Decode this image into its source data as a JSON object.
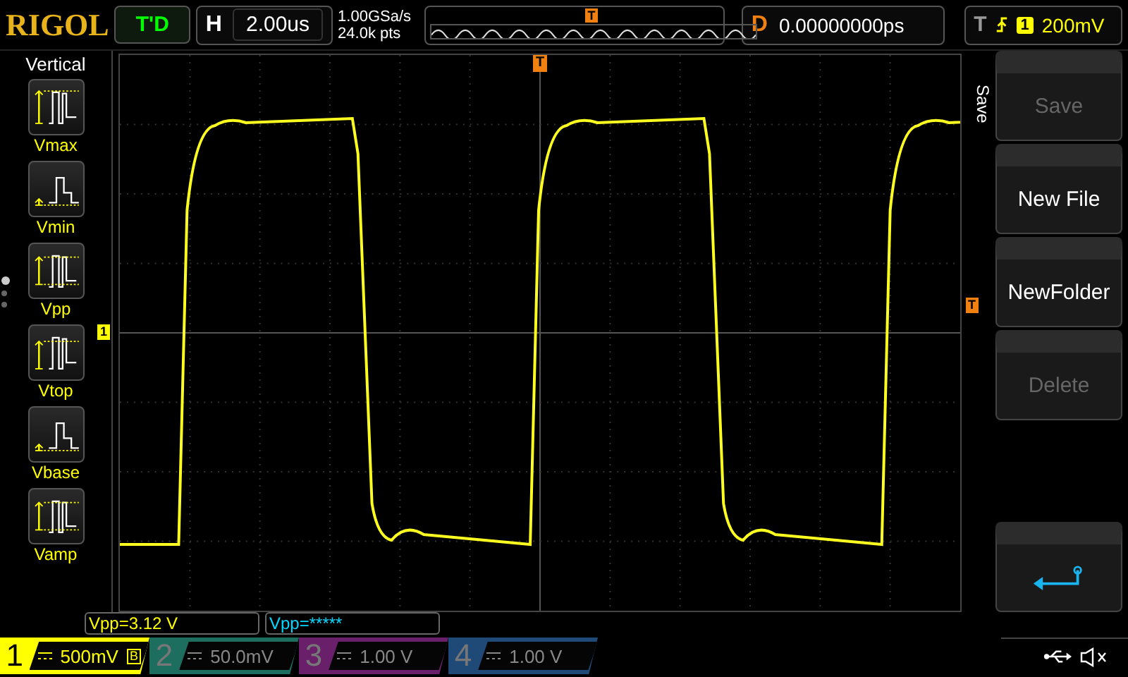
{
  "top_bar": {
    "logo": "RIGOL",
    "run_status": "T'D",
    "horizontal": {
      "label": "H",
      "value": "2.00us"
    },
    "sample_rate": "1.00GSa/s",
    "memory_depth": "24.0k pts",
    "trigger_marker": "T",
    "delay": {
      "label": "D",
      "value": "0.00000000ps"
    },
    "trigger": {
      "label": "T",
      "channel": "1",
      "level": "200mV"
    }
  },
  "sidebar": {
    "title": "Vertical",
    "items": [
      {
        "label": "Vmax",
        "kind": "vmax"
      },
      {
        "label": "Vmin",
        "kind": "vmin"
      },
      {
        "label": "Vpp",
        "kind": "vpp"
      },
      {
        "label": "Vtop",
        "kind": "vtop"
      },
      {
        "label": "Vbase",
        "kind": "vbase"
      },
      {
        "label": "Vamp",
        "kind": "vamp"
      }
    ],
    "pages": [
      {
        "selected": true
      },
      {
        "selected": false
      },
      {
        "selected": false
      }
    ]
  },
  "plot": {
    "channel_marker": "1",
    "trigger_position_marker": "T",
    "trigger_level_marker": "T"
  },
  "menu": {
    "title": "Save",
    "buttons": [
      {
        "kind": "text",
        "label": "Save",
        "disabled": true
      },
      {
        "kind": "text",
        "label": "New File",
        "disabled": false
      },
      {
        "kind": "text",
        "label": "NewFolder",
        "disabled": false
      },
      {
        "kind": "text",
        "label": "Delete",
        "disabled": true
      },
      {
        "kind": "spacer"
      },
      {
        "kind": "back"
      }
    ]
  },
  "measurements": [
    {
      "text": "Vpp=3.12 V",
      "color": "#ffff00"
    },
    {
      "text": "Vpp=*****",
      "color": "#00d8ff"
    }
  ],
  "channels": [
    {
      "number": "1",
      "scale": "500mV",
      "active": true,
      "color": "#ffff00",
      "bandwidth_limit": "B"
    },
    {
      "number": "2",
      "scale": "50.0mV",
      "active": false,
      "color": "#1e6e60"
    },
    {
      "number": "3",
      "scale": "1.00 V",
      "active": false,
      "color": "#6a1f6a"
    },
    {
      "number": "4",
      "scale": "1.00 V",
      "active": false,
      "color": "#1f4a78"
    }
  ]
}
